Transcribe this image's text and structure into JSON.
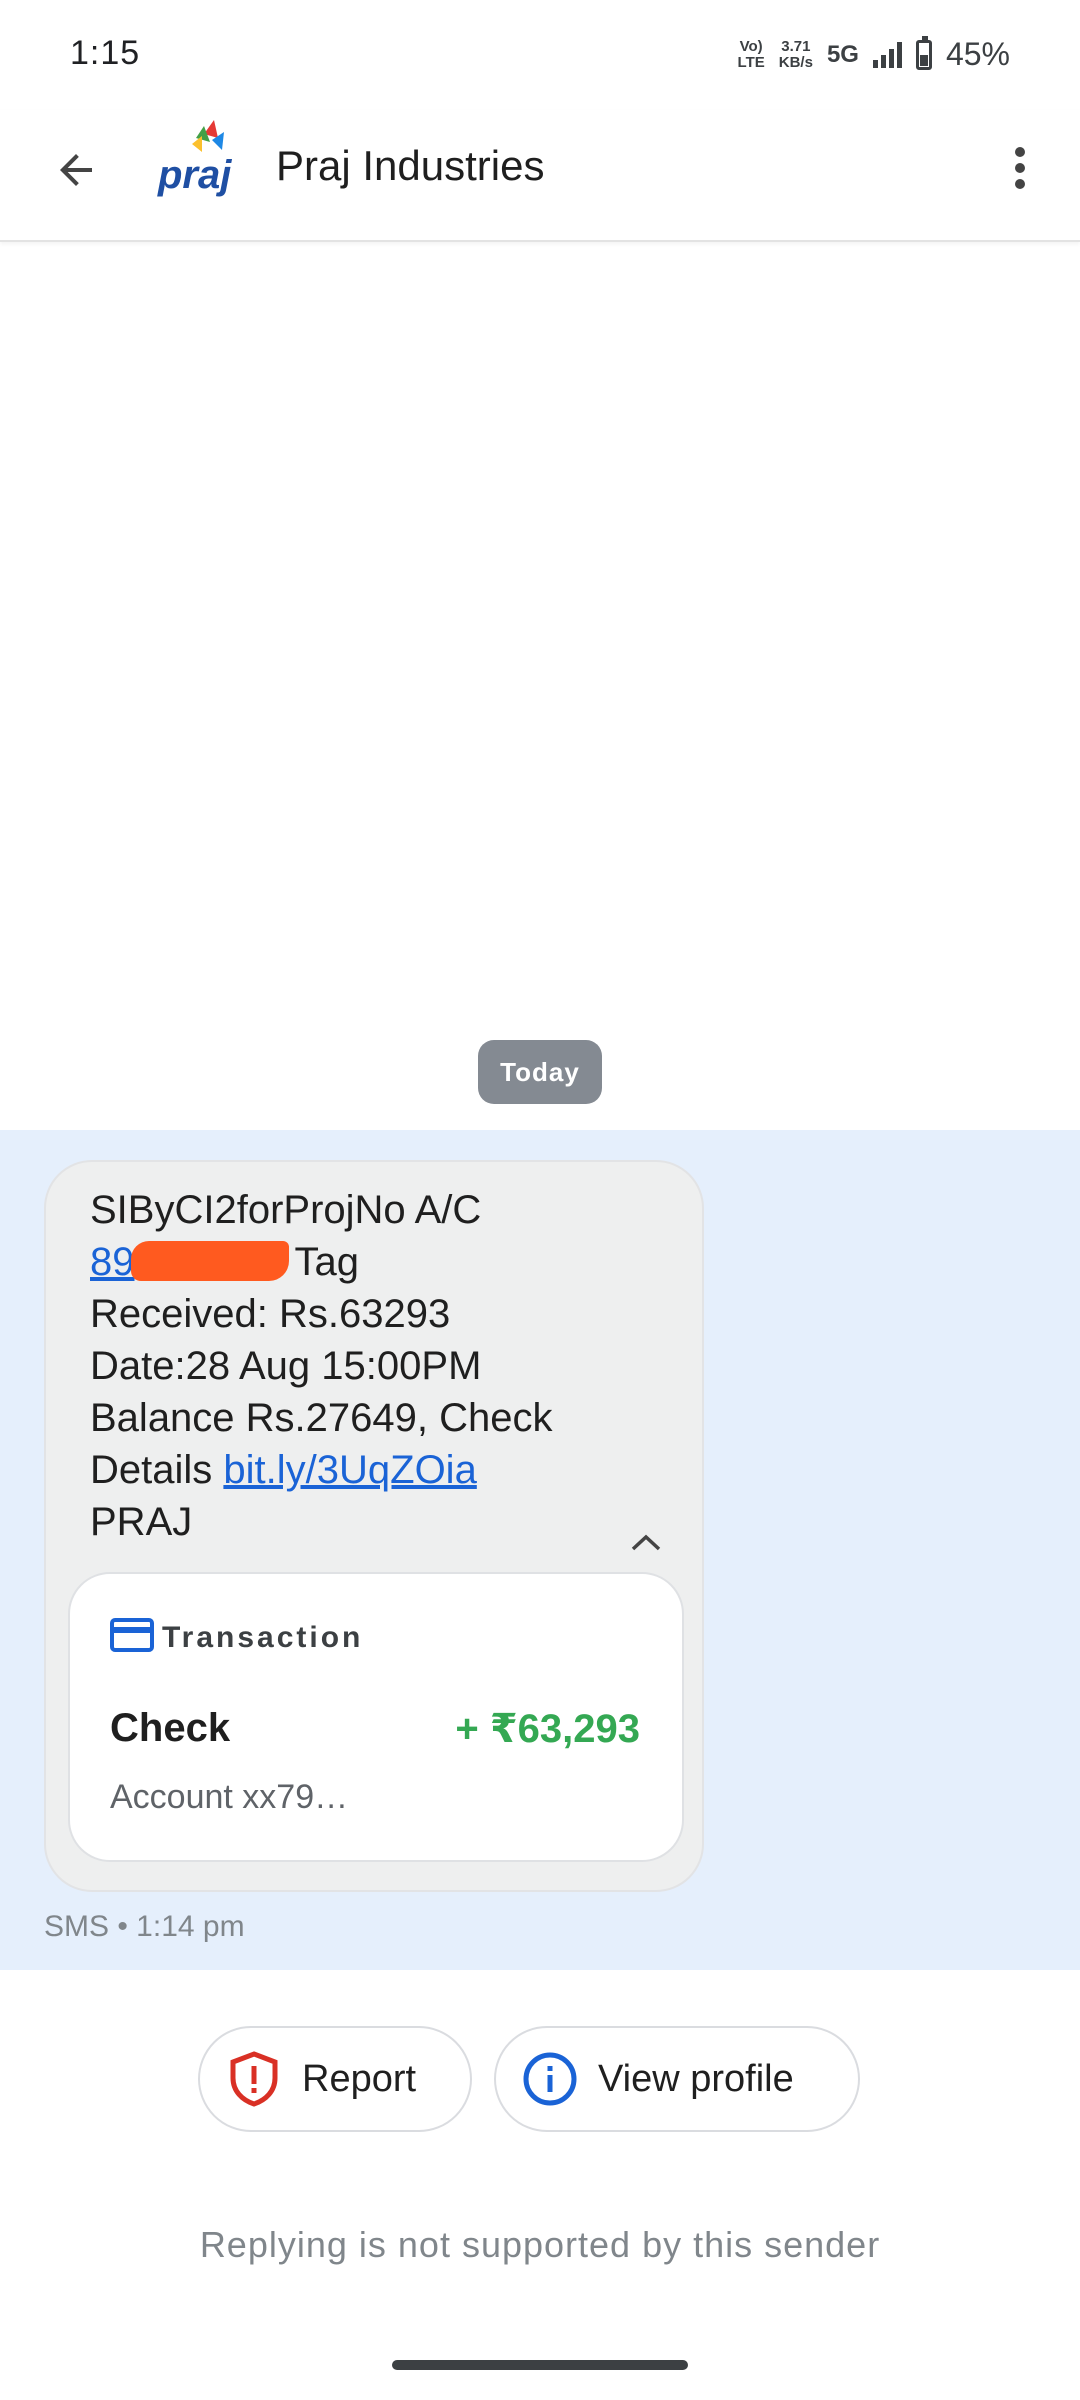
{
  "status_bar": {
    "time": "1:15",
    "volte_top": "Vo)",
    "volte_bottom": "LTE",
    "speed_top": "3.71",
    "speed_bottom": "KB/s",
    "network": "5G",
    "battery_percent": "45%",
    "battery_level": 0.45
  },
  "app_bar": {
    "title": "Praj Industries",
    "back_icon": "arrow-back-icon",
    "more_icon": "more-vert-icon",
    "logo": "praj-logo"
  },
  "conversation": {
    "date_chip": "Today",
    "message": {
      "line1": "SIByCI2forProjNo A/C",
      "account_visible": "89",
      "line2_suffix": "Tag",
      "line3": "Received: Rs.63293",
      "line4": "Date:28 Aug 15:00PM",
      "line5": "Balance Rs.27649, Check",
      "line6_prefix": "Details",
      "link": "bit.ly/3UqZOia",
      "line7": "PRAJ",
      "meta": "SMS • 1:14 pm"
    },
    "card": {
      "header_icon": "credit-card-icon",
      "header": "Transaction",
      "name": "Check",
      "amount": "+ ₹63,293",
      "sub": "Account xx79…"
    }
  },
  "actions": {
    "report_label": "Report",
    "report_icon": "shield-alert-icon",
    "profile_label": "View profile",
    "profile_icon": "info-icon"
  },
  "footer": {
    "reply_note": "Replying is not supported by this sender"
  },
  "colors": {
    "link": "#1a63d6",
    "amount_positive": "#34a853",
    "report_red": "#d93025",
    "info_blue": "#1a63d6",
    "selection_bg": "#e5effc",
    "redaction": "#ff5a1f"
  }
}
